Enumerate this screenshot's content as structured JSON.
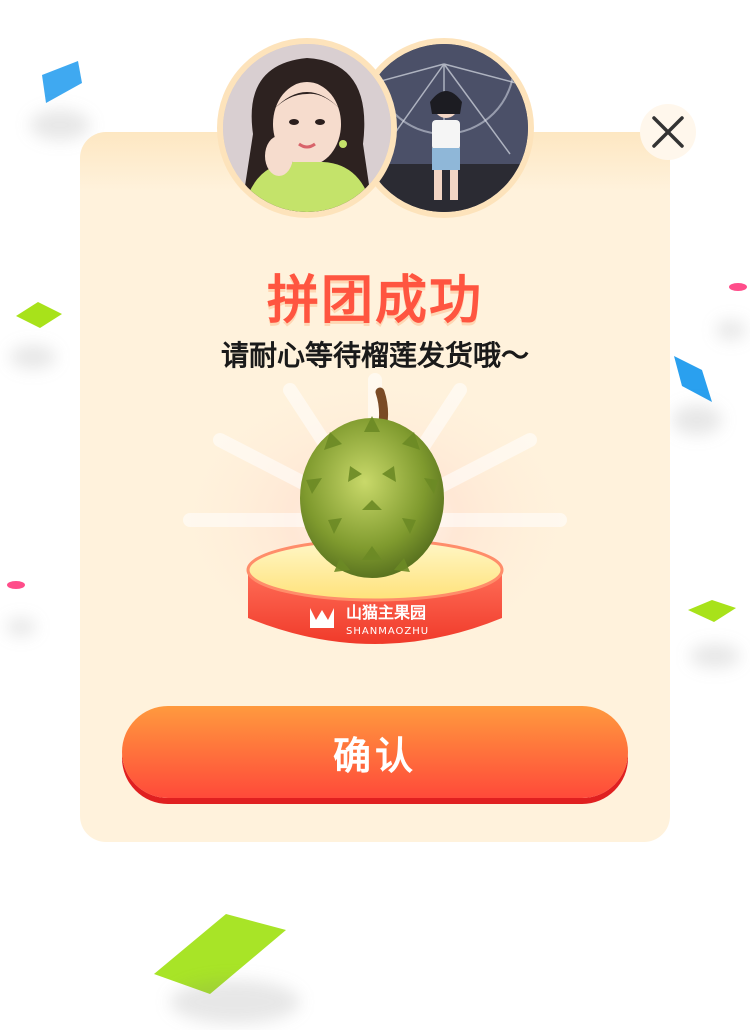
{
  "dialog": {
    "title": "拼团成功",
    "subtitle": "请耐心等待榴莲发货哦～",
    "confirm_label": "确认"
  },
  "product": {
    "icon": "durian",
    "brand_name": "山猫主果园",
    "brand_pinyin": "SHANMAOZHU"
  },
  "avatars": [
    {
      "name": "avatar-left"
    },
    {
      "name": "avatar-right"
    }
  ],
  "colors": {
    "title": "#ff5540",
    "card_bg": "#fff2dc",
    "button_top": "#ff9a3e",
    "button_bottom": "#ff4a3a",
    "pedestal": "#ff5a48"
  }
}
